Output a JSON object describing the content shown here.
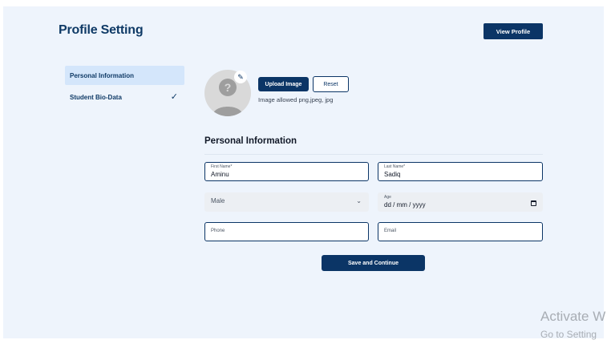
{
  "header": {
    "title": "Profile Setting",
    "view_profile_label": "View Profile"
  },
  "sidebar": {
    "items": [
      {
        "label": "Personal Information",
        "active": true
      },
      {
        "label": "Student Bio-Data",
        "completed": true
      }
    ]
  },
  "photo": {
    "upload_label": "Upload Image",
    "reset_label": "Reset",
    "hint": "Image allowed png,jpeg, jpg"
  },
  "form": {
    "section_title": "Personal Information",
    "first_name": {
      "label": "First Name*",
      "value": "Aminu"
    },
    "last_name": {
      "label": "Last Name*",
      "value": "Sadiq"
    },
    "gender": {
      "value": "Male"
    },
    "age": {
      "label": "Age",
      "placeholder": "dd / mm / yyyy"
    },
    "phone": {
      "placeholder": "Phone"
    },
    "email": {
      "placeholder": "Email"
    },
    "submit_label": "Save and Continue"
  },
  "watermark": {
    "line1": "Activate W",
    "line2": "Go to Setting"
  },
  "colors": {
    "primary": "#0b3566",
    "background": "#eef4fc",
    "active_nav": "#d4e6fb"
  },
  "icons": {
    "edit": "pencil-icon",
    "check": "check-icon",
    "dropdown": "chevron-down-icon",
    "calendar": "calendar-icon",
    "avatar": "user-placeholder-icon"
  }
}
